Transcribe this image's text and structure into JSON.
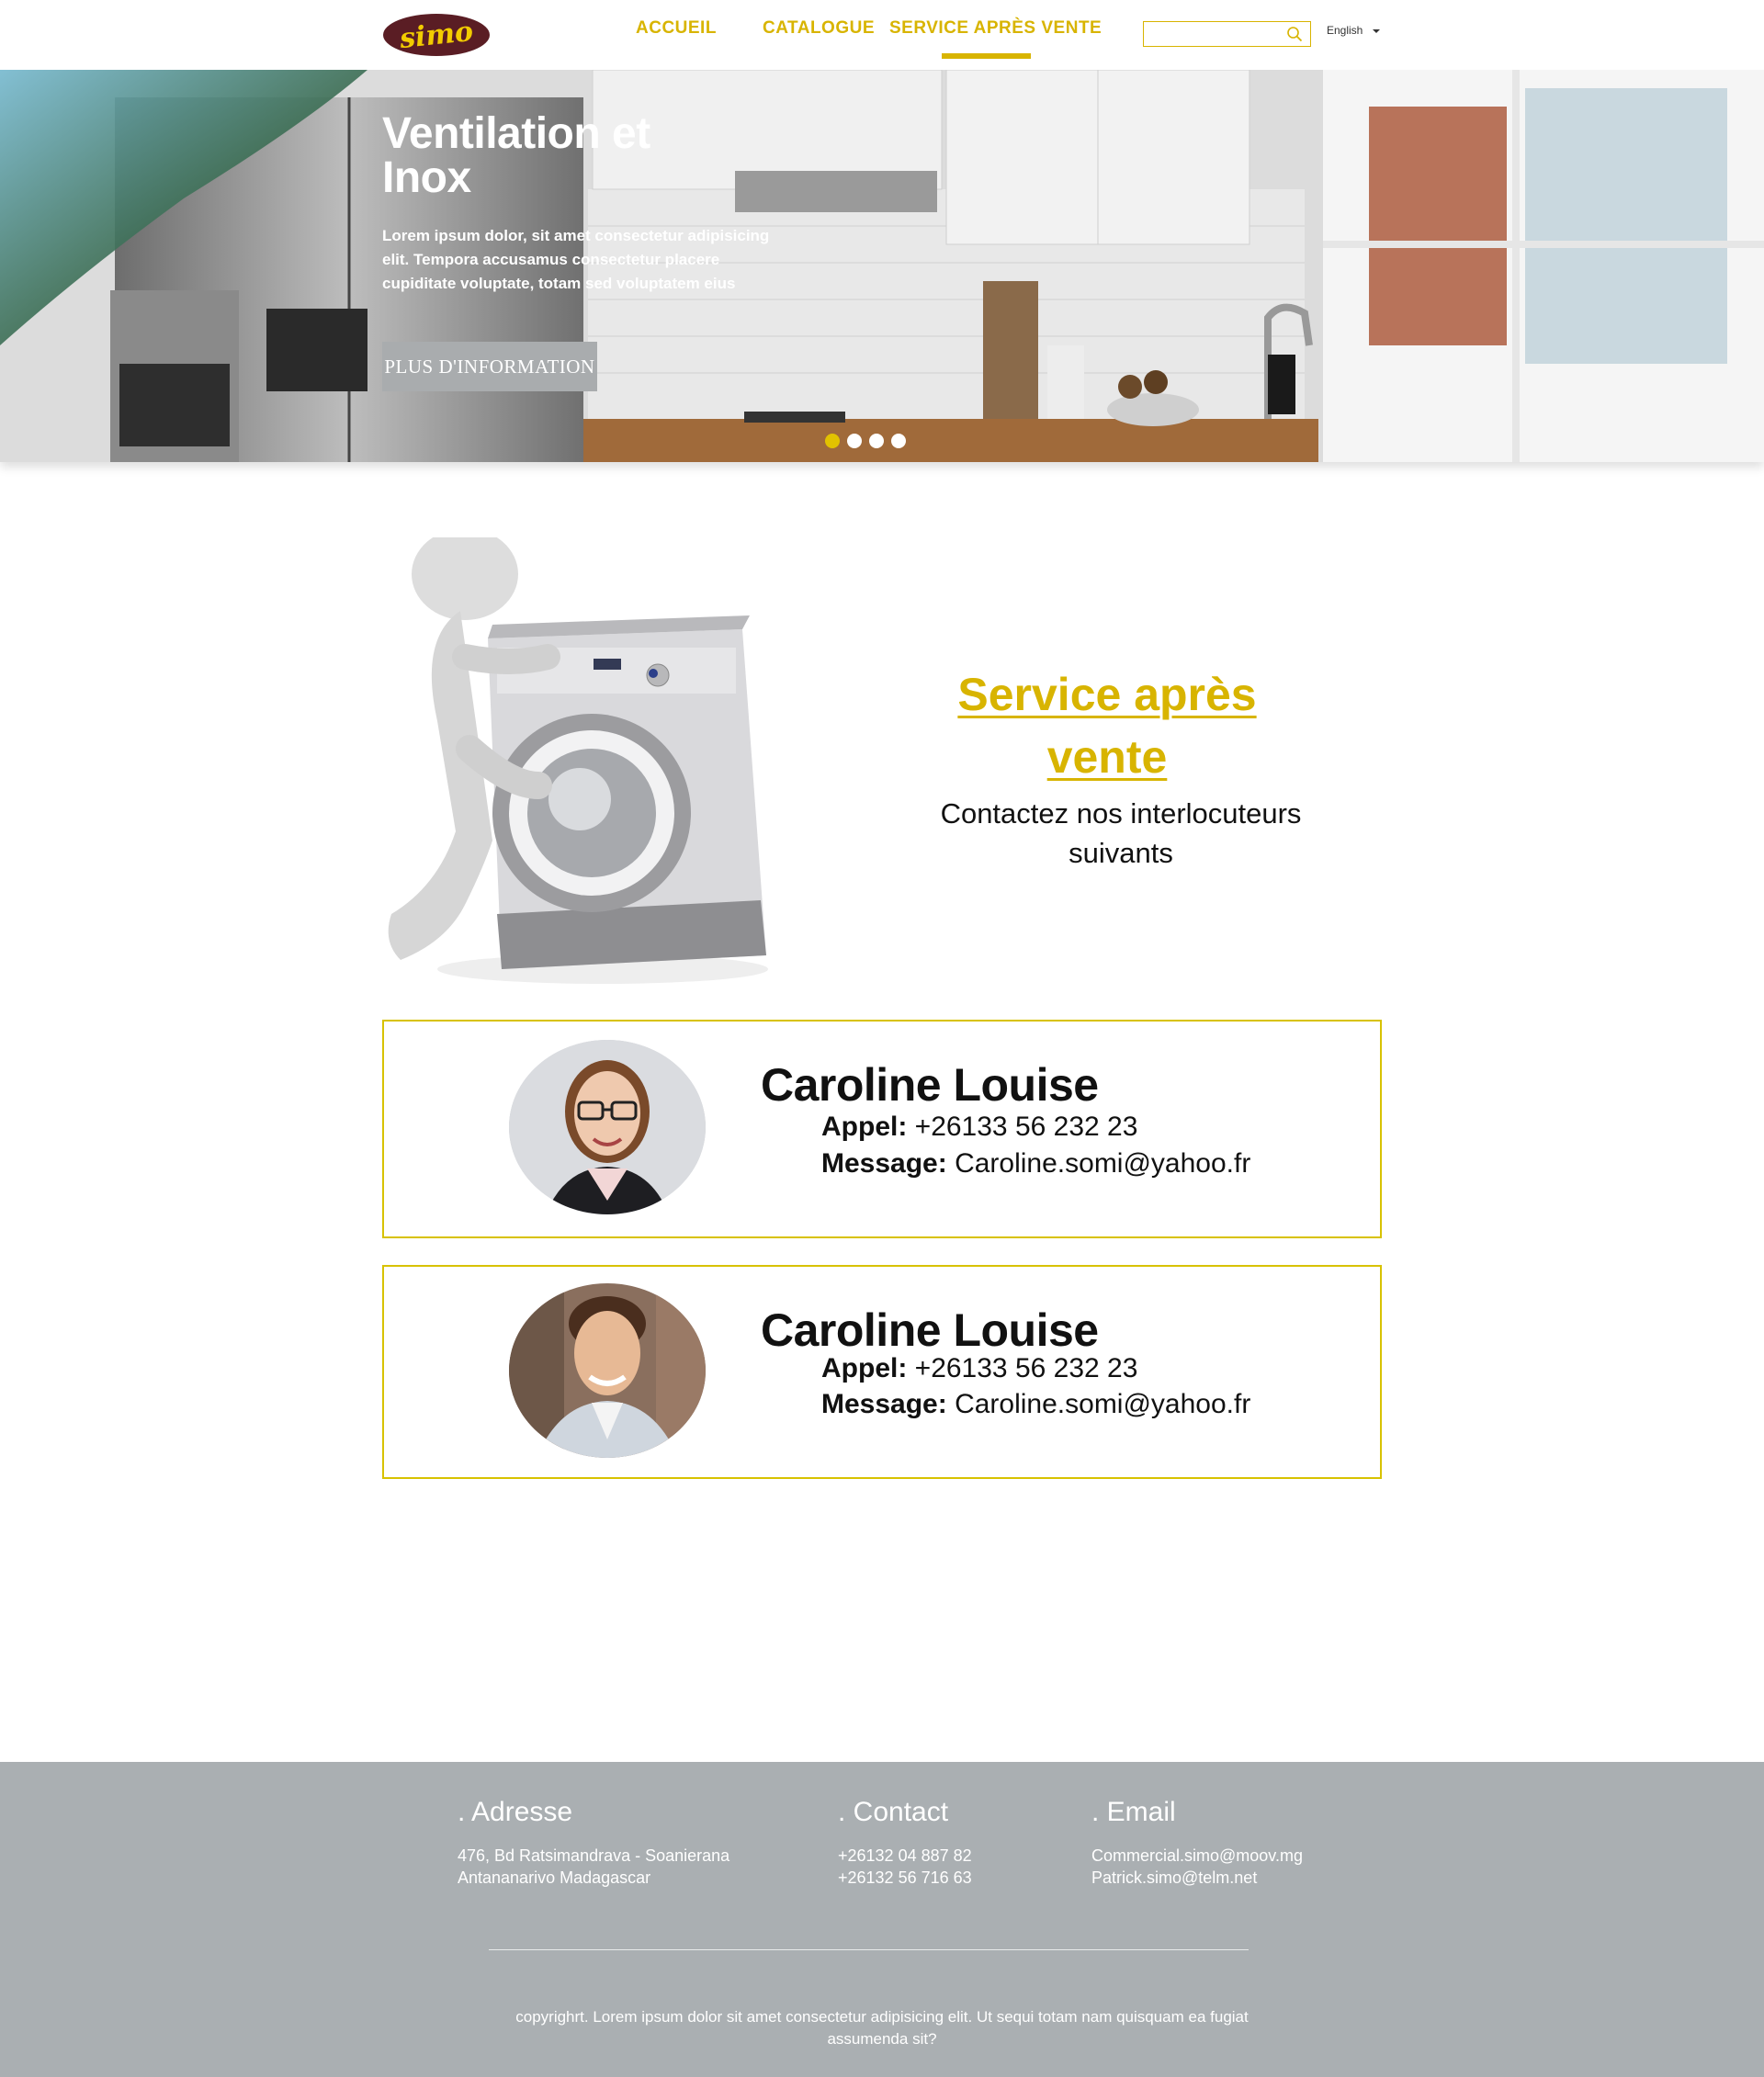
{
  "brand": {
    "logo_text": "simo",
    "accent": "#d8b400",
    "logo_color": "#5a1d24"
  },
  "nav": {
    "items": [
      "ACCUEIL",
      "CATALOGUE",
      "SERVICE APRÈS VENTE"
    ],
    "active": "SERVICE APRÈS VENTE"
  },
  "search": {
    "placeholder": "",
    "icon": "search-icon"
  },
  "language": {
    "selected": "English"
  },
  "hero": {
    "title": "Ventilation et Inox",
    "text": "Lorem ipsum dolor, sit amet consectetur adipisicing elit. Tempora accusamus consectetur placere cupiditate voluptate, totam sed voluptatem eius",
    "button": "PLUS D'INFORMATION",
    "slide_count": 4,
    "active_slide": 1
  },
  "sav": {
    "title": "Service après vente",
    "subtitle": "Contactez nos interlocuteurs suivants"
  },
  "contacts": [
    {
      "name": "Caroline Louise",
      "call_label": "Appel:",
      "call_value": "+26133 56 232 23",
      "message_label": "Message:",
      "message_value": "Caroline.somi@yahoo.fr"
    },
    {
      "name": "Caroline Louise",
      "call_label": "Appel:",
      "call_value": "+26133 56 232 23",
      "message_label": "Message:",
      "message_value": "Caroline.somi@yahoo.fr"
    }
  ],
  "footer": {
    "address_title": ". Adresse",
    "address_line1": "476, Bd Ratsimandrava - Soanierana",
    "address_line2": "Antananarivo Madagascar",
    "contact_title": ". Contact",
    "contact_line1": "+26132 04 887 82",
    "contact_line2": "+26132 56 716 63",
    "email_title": ". Email",
    "email_line1": "Commercial.simo@moov.mg",
    "email_line2": "Patrick.simo@telm.net",
    "copyright": "copyrighrt. Lorem ipsum dolor sit amet consectetur adipisicing elit. Ut sequi totam nam quisquam ea fugiat assumenda sit?"
  }
}
